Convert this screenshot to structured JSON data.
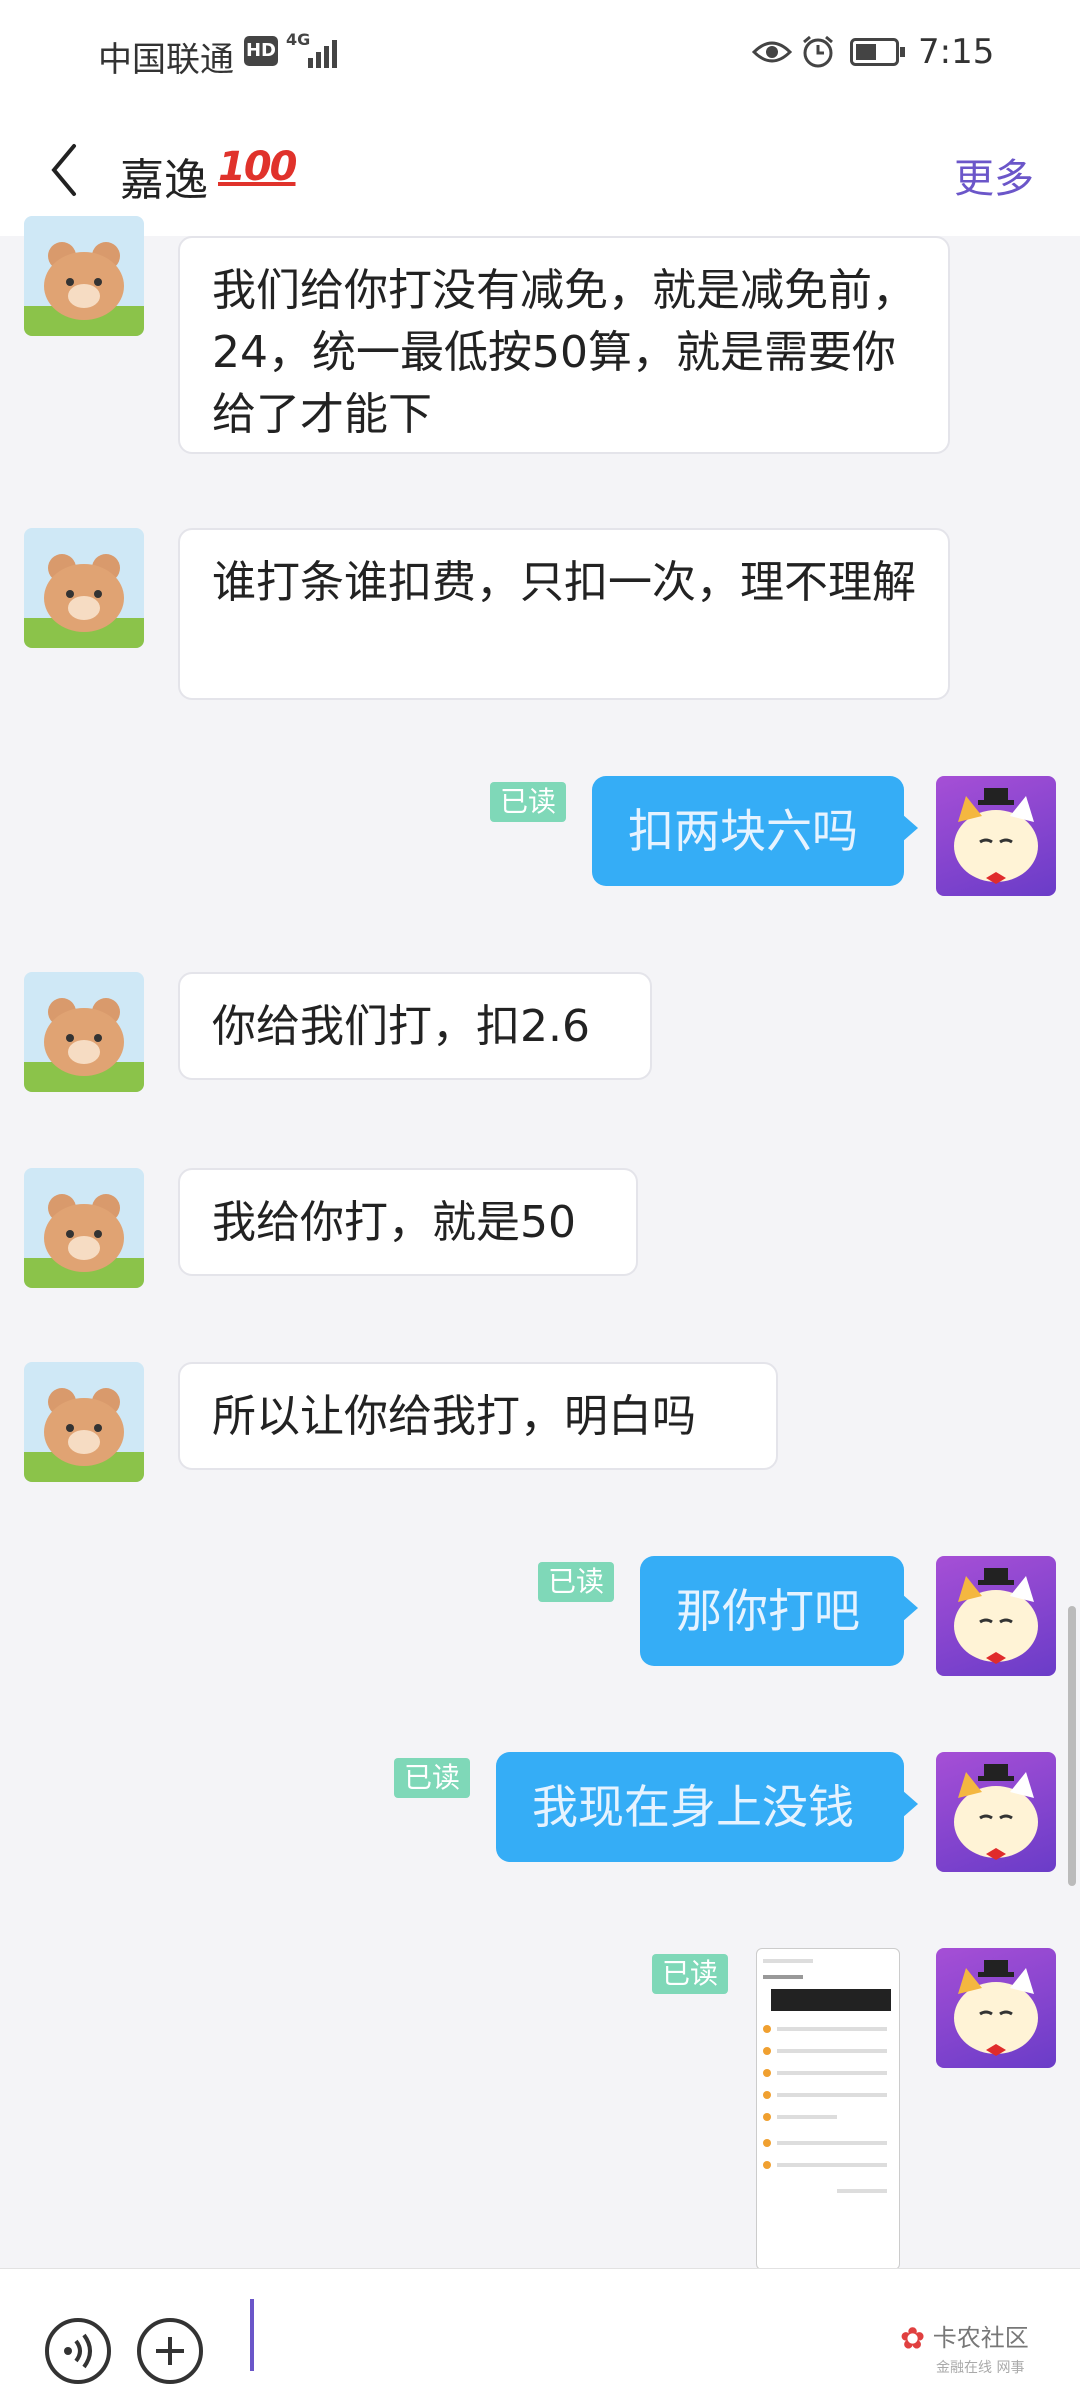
{
  "status_bar": {
    "carrier": "中国联通",
    "hd_badge": "HD",
    "network": "4G",
    "time": "7:15"
  },
  "header": {
    "title": "嘉逸",
    "title_emoji": "100",
    "more_label": "更多"
  },
  "messages": [
    {
      "side": "left",
      "text": "我们给你打没有减免，就是减免前，24，统一最低按50算，就是需要你给了才能下"
    },
    {
      "side": "left",
      "text": "谁打条谁扣费，只扣一次，理不理解"
    },
    {
      "side": "right",
      "text": "扣两块六吗",
      "read": "已读"
    },
    {
      "side": "left",
      "text": "你给我们打，扣2.6"
    },
    {
      "side": "left",
      "text": "我给你打，就是50"
    },
    {
      "side": "left",
      "text": "所以让你给我打，明白吗"
    },
    {
      "side": "right",
      "text": "那你打吧",
      "read": "已读"
    },
    {
      "side": "right",
      "text": "我现在身上没钱",
      "read": "已读"
    },
    {
      "side": "right",
      "type": "image",
      "read": "已读"
    }
  ],
  "input": {
    "placeholder": ""
  },
  "watermark": {
    "brand": "卡农社区",
    "sub": "金融在线 网事"
  },
  "colors": {
    "accent": "#6b56c9",
    "outgoing_bubble": "#35adf6",
    "read_badge": "#7fd8b8"
  }
}
